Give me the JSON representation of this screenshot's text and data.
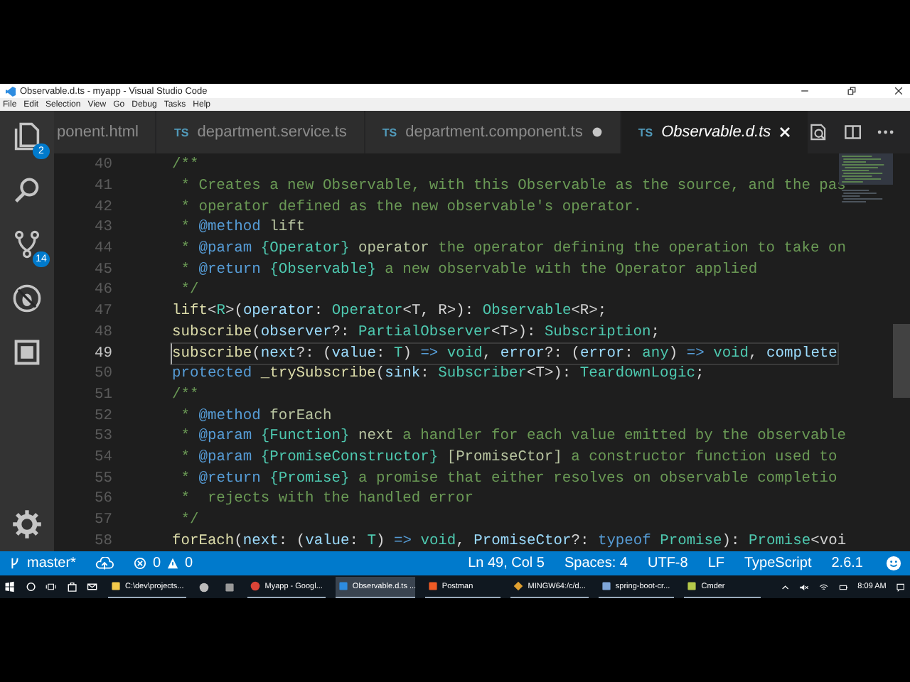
{
  "window": {
    "title": "Observable.d.ts - myapp - Visual Studio Code"
  },
  "menu": [
    "File",
    "Edit",
    "Selection",
    "View",
    "Go",
    "Debug",
    "Tasks",
    "Help"
  ],
  "activity_bar": [
    {
      "kind": "files",
      "badge": "2"
    },
    {
      "kind": "search"
    },
    {
      "kind": "source-control",
      "badge": "14"
    },
    {
      "kind": "debug"
    },
    {
      "kind": "extensions"
    },
    {
      "kind": "settings"
    }
  ],
  "tabs": [
    {
      "label": "ponent.html",
      "selected": false,
      "modified": false
    },
    {
      "lang": "TS",
      "label": "department.service.ts",
      "selected": false,
      "modified": false
    },
    {
      "lang": "TS",
      "label": "department.component.ts",
      "selected": false,
      "modified": true
    },
    {
      "lang": "TS",
      "label": "Observable.d.ts",
      "selected": true,
      "modified": false
    }
  ],
  "editor": {
    "lines": [
      {
        "number": "40",
        "current": false,
        "segments": [
          {
            "text": "/**",
            "kind": "comment"
          }
        ]
      },
      {
        "number": "41",
        "current": false,
        "segments": [
          {
            "text": " * Creates a new Observable, with this Observable as the source, and the pas",
            "kind": "comment"
          }
        ]
      },
      {
        "number": "42",
        "current": false,
        "segments": [
          {
            "text": " * operator defined as the new observable's operator.",
            "kind": "comment"
          }
        ]
      },
      {
        "number": "43",
        "current": false,
        "segments": [
          {
            "text": " * ",
            "kind": "comment"
          },
          {
            "text": "@method",
            "kind": "tag"
          },
          {
            "text": " lift",
            "kind": "docname"
          }
        ]
      },
      {
        "number": "44",
        "current": false,
        "segments": [
          {
            "text": " * ",
            "kind": "comment"
          },
          {
            "text": "@param",
            "kind": "tag"
          },
          {
            "text": " {Operator}",
            "kind": "type"
          },
          {
            "text": " operator",
            "kind": "docname"
          },
          {
            "text": " the operator defining the operation to take on",
            "kind": "comment"
          }
        ]
      },
      {
        "number": "45",
        "current": false,
        "segments": [
          {
            "text": " * ",
            "kind": "comment"
          },
          {
            "text": "@return",
            "kind": "tag"
          },
          {
            "text": " {Observable}",
            "kind": "type"
          },
          {
            "text": " a new observable with the Operator applied",
            "kind": "comment"
          }
        ]
      },
      {
        "number": "46",
        "current": false,
        "segments": [
          {
            "text": " */",
            "kind": "comment"
          }
        ]
      },
      {
        "number": "47",
        "current": false,
        "segments": [
          {
            "text": "lift",
            "kind": "fn"
          },
          {
            "text": "<",
            "kind": "plain"
          },
          {
            "text": "R",
            "kind": "type"
          },
          {
            "text": ">(",
            "kind": "plain"
          },
          {
            "text": "operator",
            "kind": "param"
          },
          {
            "text": ": ",
            "kind": "plain"
          },
          {
            "text": "Operator",
            "kind": "type"
          },
          {
            "text": "<T, R>): ",
            "kind": "plain"
          },
          {
            "text": "Observable",
            "kind": "type"
          },
          {
            "text": "<R>;",
            "kind": "plain"
          }
        ]
      },
      {
        "number": "48",
        "current": false,
        "segments": [
          {
            "text": "subscribe",
            "kind": "fn"
          },
          {
            "text": "(",
            "kind": "plain"
          },
          {
            "text": "observer",
            "kind": "param"
          },
          {
            "text": "?: ",
            "kind": "plain"
          },
          {
            "text": "PartialObserver",
            "kind": "type"
          },
          {
            "text": "<T>): ",
            "kind": "plain"
          },
          {
            "text": "Subscription",
            "kind": "type"
          },
          {
            "text": ";",
            "kind": "plain"
          }
        ]
      },
      {
        "number": "49",
        "current": true,
        "segments": [
          {
            "text": "subscribe",
            "kind": "fn"
          },
          {
            "text": "(",
            "kind": "plain"
          },
          {
            "text": "next",
            "kind": "param"
          },
          {
            "text": "?: (",
            "kind": "plain"
          },
          {
            "text": "value",
            "kind": "param"
          },
          {
            "text": ": ",
            "kind": "plain"
          },
          {
            "text": "T",
            "kind": "type"
          },
          {
            "text": ") ",
            "kind": "plain"
          },
          {
            "text": "=>",
            "kind": "keyword"
          },
          {
            "text": " void",
            "kind": "type"
          },
          {
            "text": ", ",
            "kind": "plain"
          },
          {
            "text": "error",
            "kind": "param"
          },
          {
            "text": "?: (",
            "kind": "plain"
          },
          {
            "text": "error",
            "kind": "param"
          },
          {
            "text": ": ",
            "kind": "plain"
          },
          {
            "text": "any",
            "kind": "type"
          },
          {
            "text": ") ",
            "kind": "plain"
          },
          {
            "text": "=>",
            "kind": "keyword"
          },
          {
            "text": " void",
            "kind": "type"
          },
          {
            "text": ", ",
            "kind": "plain"
          },
          {
            "text": "complete",
            "kind": "param"
          }
        ]
      },
      {
        "number": "50",
        "current": false,
        "segments": [
          {
            "text": "protected",
            "kind": "keyword"
          },
          {
            "text": " _trySubscribe",
            "kind": "fn"
          },
          {
            "text": "(",
            "kind": "plain"
          },
          {
            "text": "sink",
            "kind": "param"
          },
          {
            "text": ": ",
            "kind": "plain"
          },
          {
            "text": "Subscriber",
            "kind": "type"
          },
          {
            "text": "<T>): ",
            "kind": "plain"
          },
          {
            "text": "TeardownLogic",
            "kind": "type"
          },
          {
            "text": ";",
            "kind": "plain"
          }
        ]
      },
      {
        "number": "51",
        "current": false,
        "segments": [
          {
            "text": "/**",
            "kind": "comment"
          }
        ]
      },
      {
        "number": "52",
        "current": false,
        "segments": [
          {
            "text": " * ",
            "kind": "comment"
          },
          {
            "text": "@method",
            "kind": "tag"
          },
          {
            "text": " forEach",
            "kind": "docname"
          }
        ]
      },
      {
        "number": "53",
        "current": false,
        "segments": [
          {
            "text": " * ",
            "kind": "comment"
          },
          {
            "text": "@param",
            "kind": "tag"
          },
          {
            "text": " {Function}",
            "kind": "type"
          },
          {
            "text": " next",
            "kind": "docname"
          },
          {
            "text": " a handler for each value emitted by the observable",
            "kind": "comment"
          }
        ]
      },
      {
        "number": "54",
        "current": false,
        "segments": [
          {
            "text": " * ",
            "kind": "comment"
          },
          {
            "text": "@param",
            "kind": "tag"
          },
          {
            "text": " {PromiseConstructor}",
            "kind": "type"
          },
          {
            "text": " [PromiseCtor]",
            "kind": "docname"
          },
          {
            "text": " a constructor function used to",
            "kind": "comment"
          }
        ]
      },
      {
        "number": "55",
        "current": false,
        "segments": [
          {
            "text": " * ",
            "kind": "comment"
          },
          {
            "text": "@return",
            "kind": "tag"
          },
          {
            "text": " {Promise}",
            "kind": "type"
          },
          {
            "text": " a promise that either resolves on observable completio",
            "kind": "comment"
          }
        ]
      },
      {
        "number": "56",
        "current": false,
        "segments": [
          {
            "text": " *  rejects with the handled error",
            "kind": "comment"
          }
        ]
      },
      {
        "number": "57",
        "current": false,
        "segments": [
          {
            "text": " */",
            "kind": "comment"
          }
        ]
      },
      {
        "number": "58",
        "current": false,
        "segments": [
          {
            "text": "forEach",
            "kind": "fn"
          },
          {
            "text": "(",
            "kind": "plain"
          },
          {
            "text": "next",
            "kind": "param"
          },
          {
            "text": ": (",
            "kind": "plain"
          },
          {
            "text": "value",
            "kind": "param"
          },
          {
            "text": ": ",
            "kind": "plain"
          },
          {
            "text": "T",
            "kind": "type"
          },
          {
            "text": ") ",
            "kind": "plain"
          },
          {
            "text": "=>",
            "kind": "keyword"
          },
          {
            "text": " void",
            "kind": "type"
          },
          {
            "text": ", ",
            "kind": "plain"
          },
          {
            "text": "PromiseCtor",
            "kind": "param"
          },
          {
            "text": "?: ",
            "kind": "plain"
          },
          {
            "text": "typeof",
            "kind": "keyword"
          },
          {
            "text": " Promise",
            "kind": "type"
          },
          {
            "text": "): ",
            "kind": "plain"
          },
          {
            "text": "Promise",
            "kind": "type"
          },
          {
            "text": "<voi",
            "kind": "plain"
          }
        ]
      }
    ]
  },
  "status_bar": {
    "branch": "master*",
    "errors": "0",
    "warnings": "0",
    "items": [
      "Ln 49, Col 5",
      "Spaces: 4",
      "UTF-8",
      "LF",
      "TypeScript",
      "2.6.1"
    ]
  },
  "taskbar": {
    "items": [
      {
        "kind": "folder",
        "label": "C:\\dev\\projects...",
        "selected": false
      },
      {
        "kind": "app",
        "selected": false
      },
      {
        "kind": "tool",
        "selected": false
      },
      {
        "kind": "browser",
        "label": "Myapp - Googl...",
        "selected": false
      },
      {
        "kind": "editor",
        "label": "Observable.d.ts ...",
        "selected": true
      },
      {
        "kind": "postman",
        "label": "Postman",
        "selected": false
      },
      {
        "kind": "git",
        "label": "MINGW64:/c/d...",
        "selected": false
      },
      {
        "kind": "box",
        "label": "spring-boot-cr...",
        "selected": false
      },
      {
        "kind": "terminal",
        "label": "Cmder",
        "selected": false
      }
    ],
    "clock": "8:09 AM"
  }
}
